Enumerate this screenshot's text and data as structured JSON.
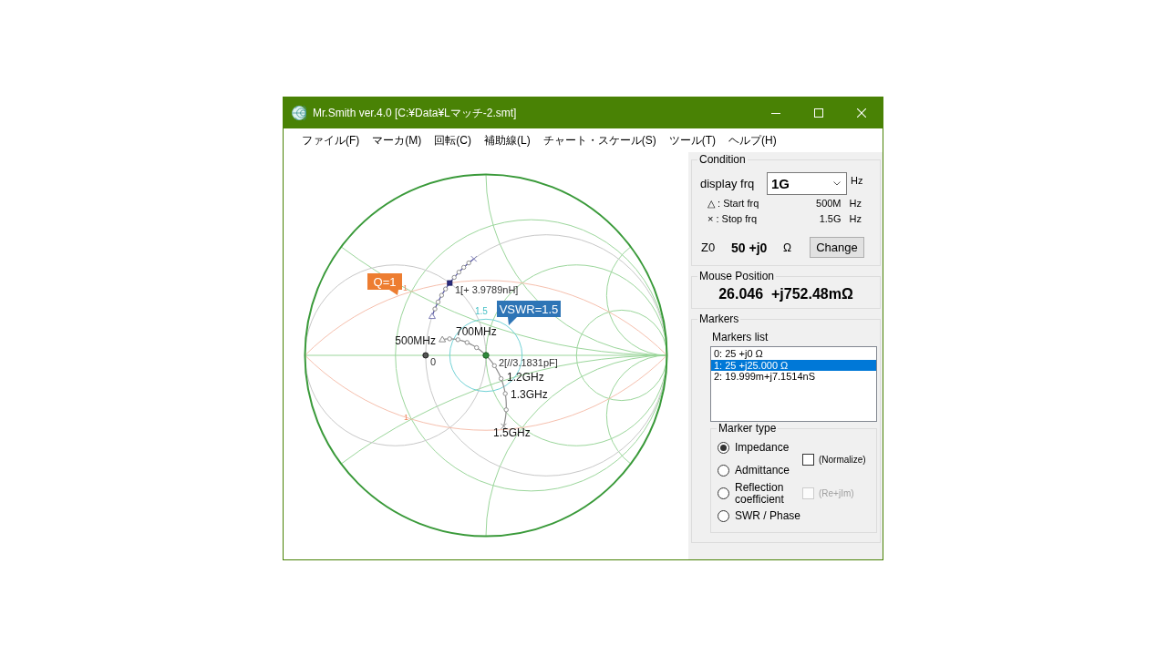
{
  "window": {
    "title": "Mr.Smith ver.4.0 [C:¥Data¥Lマッチ-2.smt]"
  },
  "menu": [
    "ファイル(F)",
    "マーカ(M)",
    "回転(C)",
    "補助線(L)",
    "チャート・スケール(S)",
    "ツール(T)",
    "ヘルプ(H)"
  ],
  "chart": {
    "labels": [
      {
        "kind": "frequency",
        "text": "500MHz"
      },
      {
        "kind": "frequency",
        "text": "700MHz"
      },
      {
        "kind": "frequency",
        "text": "1.2GHz"
      },
      {
        "kind": "frequency",
        "text": "1.3GHz"
      },
      {
        "kind": "frequency",
        "text": "1.5GHz"
      },
      {
        "kind": "marker",
        "text": "0"
      },
      {
        "kind": "marker",
        "text": "1[+ 3.9789nH]"
      },
      {
        "kind": "marker",
        "text": "2[//3.1831pF]"
      },
      {
        "kind": "vswr",
        "text": "1.5"
      },
      {
        "kind": "q",
        "text": "1"
      },
      {
        "kind": "q",
        "text": "1"
      }
    ],
    "callouts": [
      {
        "text": "Q=1",
        "color": "#ed7d31"
      },
      {
        "text": "VSWR=1.5",
        "color": "#2e75b6"
      }
    ]
  },
  "condition": {
    "title": "Condition",
    "display_frq": {
      "label": "display frq",
      "value": "1G",
      "unit": "Hz"
    },
    "range": [
      {
        "label": "△ : Start frq",
        "value": "500M",
        "unit": "Hz"
      },
      {
        "label": "× : Stop frq",
        "value": "1.5G",
        "unit": "Hz"
      }
    ],
    "z0": {
      "label": "Z0",
      "value": "50 +j0",
      "unit": "Ω"
    },
    "button": "Change"
  },
  "mouse_position": {
    "title": "Mouse Position",
    "value": "26.046  +j752.48mΩ"
  },
  "markers": {
    "title": "Markers",
    "list_label": "Markers list",
    "items": [
      {
        "text": "0: 25 +j0 Ω",
        "selected": false
      },
      {
        "text": "1: 25 +j25.000 Ω",
        "selected": true
      },
      {
        "text": "2: 19.999m+j7.1514nS",
        "selected": false
      }
    ],
    "marker_type": {
      "title": "Marker type",
      "options": [
        {
          "label": "Impedance",
          "selected": true
        },
        {
          "label": "Admittance",
          "selected": false
        },
        {
          "label": "Reflection coefficient",
          "selected": false
        },
        {
          "label": "SWR / Phase",
          "selected": false
        }
      ],
      "checkboxes": [
        {
          "label": "(Normalize)",
          "checked": false,
          "disabled": false
        },
        {
          "label": "(Re+jIm)",
          "checked": false,
          "disabled": true
        }
      ]
    }
  }
}
